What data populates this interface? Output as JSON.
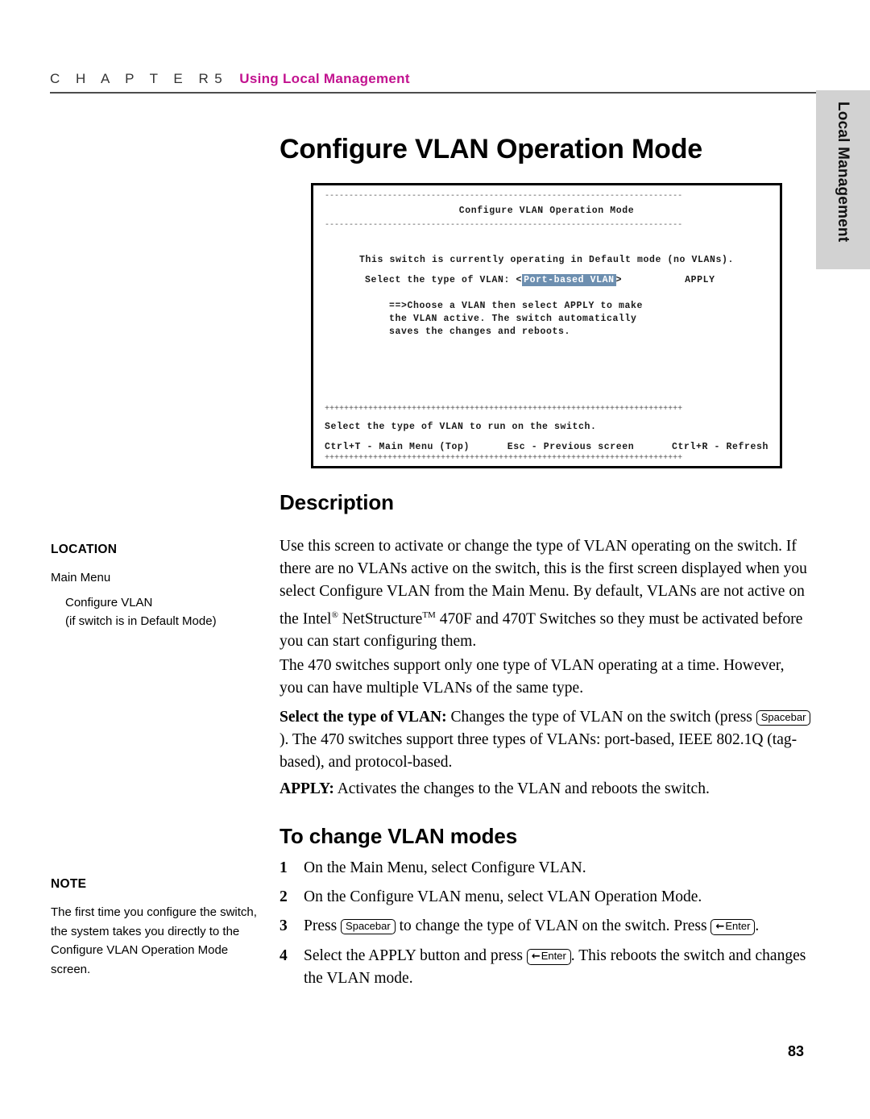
{
  "header": {
    "chapter_word": "C H A P T E R",
    "chapter_number": "5",
    "chapter_title": "Using Local Management"
  },
  "side_tab": {
    "label": "Local Management",
    "background_color": "#d2d2d2"
  },
  "page": {
    "title": "Configure VLAN Operation Mode",
    "number": "83"
  },
  "terminal": {
    "title": "Configure VLAN Operation Mode",
    "rule_top": "--------------------------------------------------------------------------",
    "rule_under_title": "--------------------------------------------------------------------------",
    "status_line": "This switch is currently operating in Default mode (no VLANs).",
    "field_label": "Select the type of VLAN:",
    "field_open_bracket": "<",
    "field_value": "Port-based VLAN",
    "field_close_bracket": ">",
    "apply_label": "APPLY",
    "note_line_1": "==>Choose a VLAN then select APPLY to make",
    "note_line_2": "the VLAN active. The switch automatically",
    "note_line_3": "saves the changes and reboots.",
    "rule_footer": "++++++++++++++++++++++++++++++++++++++++++++++++++++++++++++++++++++++++++",
    "help_line": "Select the type of VLAN to run on the switch.",
    "key_main_menu": "Ctrl+T - Main Menu (Top)",
    "key_previous": "Esc - Previous screen",
    "key_refresh": "Ctrl+R - Refresh",
    "rule_bottom": "++++++++++++++++++++++++++++++++++++++++++++++++++++++++++++++++++++++++++",
    "highlight_color": "#6d8fb0"
  },
  "sections": {
    "description_heading": "Description",
    "to_change_heading": "To change VLAN modes"
  },
  "location_block": {
    "title": "LOCATION",
    "line_1": "Main Menu",
    "line_2": "Configure VLAN",
    "line_3": "(if switch is in Default Mode)"
  },
  "note_block": {
    "title": "NOTE",
    "text": "The first time you configure the switch, the system takes you directly to the Configure VLAN Operation Mode screen."
  },
  "description": {
    "para_1_a": "Use this screen to activate or change the type of VLAN operating on the switch. If there are no VLANs active on the switch, this is the first screen displayed when you select Configure VLAN from the Main Menu. By default, VLANs are not active on the Intel",
    "para_1_reg": "®",
    "para_1_b": " NetStructure",
    "para_1_tm": "TM",
    "para_1_c": " 470F and 470T Switches so they must be activated before you can start configuring them.",
    "para_2": "The 470 switches support only one type of VLAN operating at a time. However, you can have multiple VLANs of the same type.",
    "para_3_lead": "Select the type of VLAN:",
    "para_3_a": " Changes the type of VLAN on the switch (press ",
    "para_3_key": "Spacebar",
    "para_3_b": "). The 470 switches support three types of VLANs: port-based, IEEE 802.1Q (tag-based), and protocol-based.",
    "para_4_lead": "APPLY:",
    "para_4_text": " Activates the changes to the VLAN and reboots the switch."
  },
  "steps": [
    {
      "number": "1",
      "text_a": "On the Main Menu, select Configure VLAN.",
      "key_1": "",
      "text_b": "",
      "key_2": "",
      "text_c": ""
    },
    {
      "number": "2",
      "text_a": "On the Configure VLAN menu, select VLAN Operation Mode.",
      "key_1": "",
      "text_b": "",
      "key_2": "",
      "text_c": ""
    },
    {
      "number": "3",
      "text_a": "Press ",
      "key_1": "Spacebar",
      "text_b": " to change the type of VLAN on the switch. Press ",
      "key_2": "Enter",
      "text_c": "."
    },
    {
      "number": "4",
      "text_a": "Select the APPLY button and press ",
      "key_1": "Enter",
      "text_b": ". This reboots the switch and changes the VLAN mode.",
      "key_2": "",
      "text_c": ""
    }
  ],
  "keys": {
    "spacebar_label": "Spacebar",
    "enter_label": "Enter",
    "enter_arrow": "←"
  }
}
